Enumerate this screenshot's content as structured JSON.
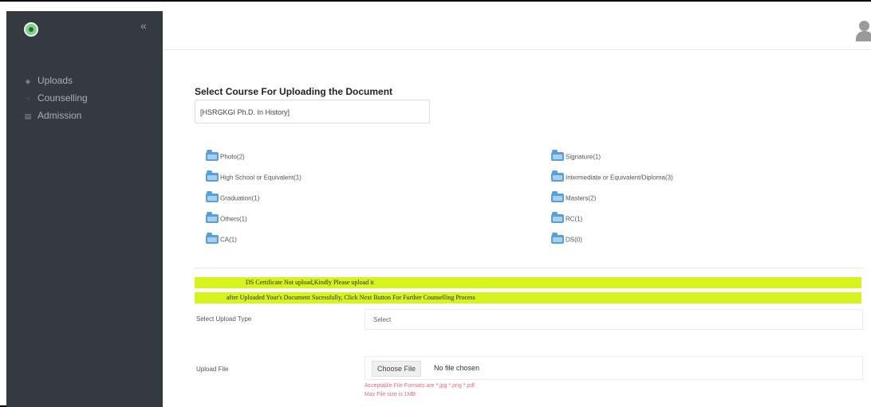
{
  "sidebar": {
    "collapse_icon": "chevron-left-icon",
    "items": [
      {
        "label": "Uploads",
        "icon": "upload-icon"
      },
      {
        "label": "Counselling",
        "icon": "counselling-icon"
      },
      {
        "label": "Admission",
        "icon": "admission-icon"
      }
    ]
  },
  "header": {
    "avatar_icon": "user-avatar-icon"
  },
  "course": {
    "title": "Select Course For Uploading the Document",
    "selected": "[HSRGKGI Ph.D. In History]"
  },
  "documents": [
    "Photo(2)",
    "Signature(1)",
    "High School or Equivalent(1)",
    "Intermediate or Equivalent/Diploma(3)",
    "Graduation(1)",
    "Masters(2)",
    "Others(1)",
    "RC(1)",
    "CA(1)",
    "DS(0)"
  ],
  "notices": [
    "DS Certificate Not upload,Kindly Please upload it",
    "after Uploaded Your's Document Sucessfully, Click Next Button For Further Counselling Process"
  ],
  "form": {
    "upload_type_label": "Select Upload Type",
    "upload_type_value": "Select",
    "upload_file_label": "Upload File",
    "choose_file_button": "Choose File",
    "file_status": "No file chosen",
    "formats_hint": "Acceptable File Formats are *.jpg *.png *.pdf",
    "size_hint": "Max File size is 1MB"
  },
  "colors": {
    "sidebar_bg": "#343a40",
    "notice_bg": "#d7f31d",
    "hint": "#e46b7b"
  }
}
